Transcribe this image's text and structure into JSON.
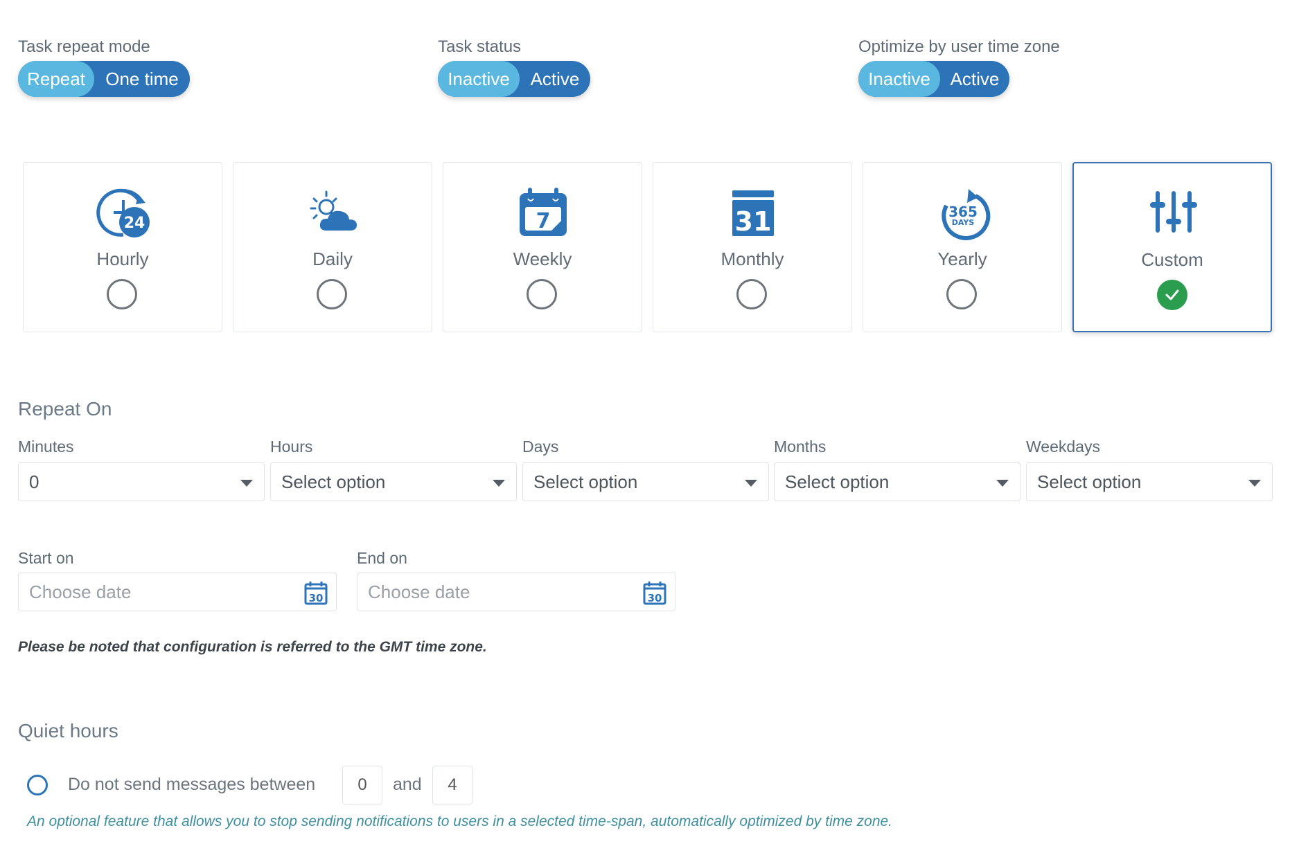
{
  "toggles": [
    {
      "label": "Task repeat mode",
      "option_on": "Repeat",
      "option_off": "One time",
      "selected": "Repeat"
    },
    {
      "label": "Task status",
      "option_on": "Inactive",
      "option_off": "Active",
      "selected": "Inactive"
    },
    {
      "label": "Optimize by user time zone",
      "option_on": "Inactive",
      "option_off": "Active",
      "selected": "Inactive"
    }
  ],
  "frequency": {
    "options": [
      {
        "label": "Hourly",
        "icon": "clock-24-icon",
        "badge": "24",
        "selected": false
      },
      {
        "label": "Daily",
        "icon": "sun-cloud-icon",
        "selected": false
      },
      {
        "label": "Weekly",
        "icon": "calendar-7-icon",
        "badge": "7",
        "selected": false
      },
      {
        "label": "Monthly",
        "icon": "calendar-31-icon",
        "badge": "31",
        "selected": false
      },
      {
        "label": "Yearly",
        "icon": "365-days-icon",
        "badge": "365",
        "badge_sub": "DAYS",
        "selected": false
      },
      {
        "label": "Custom",
        "icon": "sliders-icon",
        "selected": true
      }
    ]
  },
  "repeat_on": {
    "title": "Repeat On",
    "fields": [
      {
        "label": "Minutes",
        "value": "0"
      },
      {
        "label": "Hours",
        "value": "Select option"
      },
      {
        "label": "Days",
        "value": "Select option"
      },
      {
        "label": "Months",
        "value": "Select option"
      },
      {
        "label": "Weekdays",
        "value": "Select option"
      }
    ]
  },
  "dates": {
    "start": {
      "label": "Start on",
      "placeholder": "Choose date",
      "icon_badge": "30"
    },
    "end": {
      "label": "End on",
      "placeholder": "Choose date",
      "icon_badge": "30"
    }
  },
  "note": "Please be noted that configuration is referred to the GMT time zone.",
  "quiet_hours": {
    "title": "Quiet hours",
    "text": "Do not send messages between",
    "from": "0",
    "and_label": "and",
    "to": "4",
    "hint": "An optional feature that allows you to stop sending notifications to users in a selected time-span, automatically optimized by time zone."
  },
  "colors": {
    "brand": "#2d73b8",
    "toggle_active": "#5ab8e0",
    "checked": "#2a9d4f",
    "hint": "#3e8f9f"
  }
}
